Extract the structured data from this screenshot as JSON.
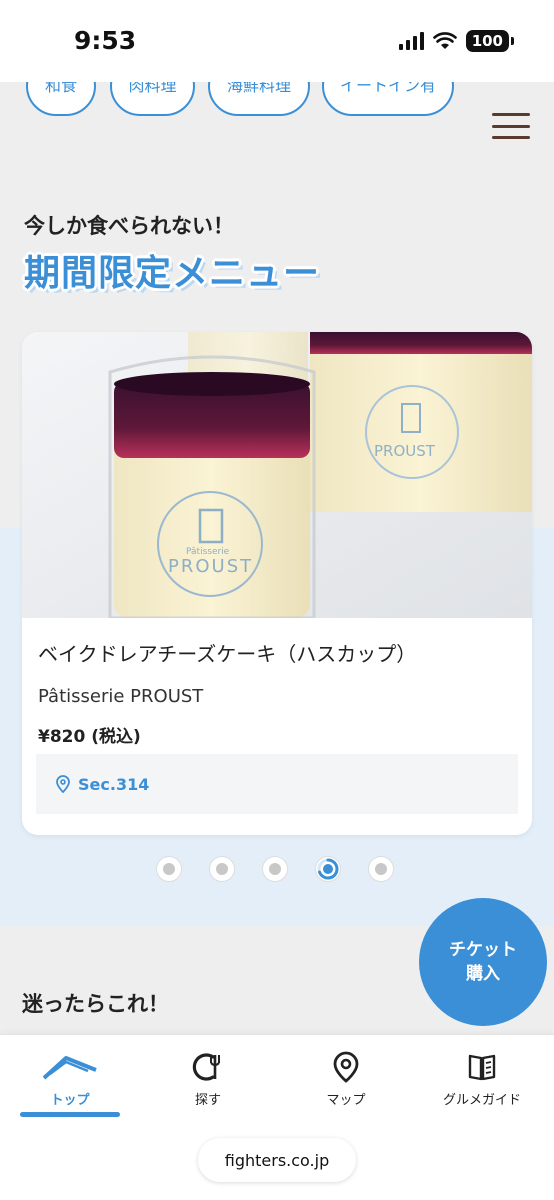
{
  "status_bar": {
    "time": "9:53",
    "battery": "100"
  },
  "tags": [
    "和食",
    "肉料理",
    "海鮮料理",
    "イートイン有"
  ],
  "section": {
    "subtitle": "今しか食べられない！",
    "title": "期間限定メニュー"
  },
  "card": {
    "name": "ベイクドレアチーズケーキ（ハスカップ）",
    "shop": "Pâtisserie PROUST",
    "price": "¥820 (税込)",
    "location": "Sec.314",
    "image_text_brand": "PROUST",
    "image_text_small": "Pâtisserie"
  },
  "carousel": {
    "count": 5,
    "active_index": 3
  },
  "ticket_button": {
    "line1": "チケット",
    "line2": "購入"
  },
  "section2": {
    "title": "迷ったらこれ！"
  },
  "bottom_nav": [
    {
      "label": "トップ",
      "icon": "home-icon",
      "active": true
    },
    {
      "label": "探す",
      "icon": "search-dining-icon",
      "active": false
    },
    {
      "label": "マップ",
      "icon": "map-pin-icon",
      "active": false
    },
    {
      "label": "グルメガイド",
      "icon": "book-icon",
      "active": false
    }
  ],
  "browser": {
    "url": "fighters.co.jp"
  },
  "colors": {
    "accent": "#3b8fd6",
    "menu_icon": "#5a3a2e",
    "band": "#e3eef9"
  }
}
